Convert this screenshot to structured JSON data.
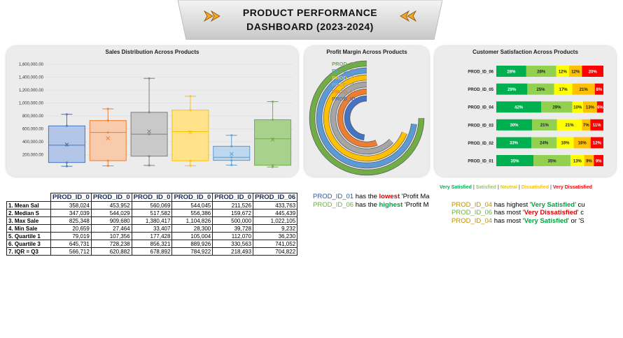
{
  "title": {
    "line1": "PRODUCT PERFORMANCE",
    "line2": "DASHBOARD (2023-2024)"
  },
  "sales_panel": {
    "title": "Sales Distribution Across Products"
  },
  "margin_panel": {
    "title": "Profit Margin Across Products"
  },
  "satisfaction_panel": {
    "title": "Customer Satisfaction Across Products"
  },
  "chart_data": [
    {
      "type": "box",
      "title": "Sales Distribution Across Products",
      "y_ticks": [
        "1,600,000.00",
        "1,400,000.00",
        "1,200,000.00",
        "1,000,000.00",
        "800,000.00",
        "600,000.00",
        "400,000.00",
        "200,000.00"
      ],
      "ylim": [
        0,
        1600000
      ],
      "series": [
        {
          "min": 20659,
          "q1": 79019,
          "median": 347039,
          "q3": 645731,
          "max": 825348,
          "mean": 358024,
          "color": "#4472c4",
          "fill": "#b4c6e7"
        },
        {
          "min": 27464,
          "q1": 107356,
          "median": 544029,
          "q3": 728238,
          "max": 909680,
          "mean": 453952,
          "color": "#ed7d31",
          "fill": "#f8cbad"
        },
        {
          "min": 33407,
          "q1": 177428,
          "median": 517582,
          "q3": 856321,
          "max": 1380417,
          "mean": 560069,
          "color": "#7f7f7f",
          "fill": "#c9c9c9"
        },
        {
          "min": 28300,
          "q1": 105004,
          "median": 556386,
          "q3": 889926,
          "max": 1104826,
          "mean": 544045,
          "color": "#ffc000",
          "fill": "#ffe28a"
        },
        {
          "min": 39728,
          "q1": 112070,
          "median": 159672,
          "q3": 330563,
          "max": 500000,
          "mean": 211526,
          "color": "#5b9bd5",
          "fill": "#bdd7ee"
        },
        {
          "min": 9232,
          "q1": 36230,
          "median": 445439,
          "q3": 741052,
          "max": 1022105,
          "mean": 433763,
          "color": "#70ad47",
          "fill": "#a9d18e"
        }
      ]
    },
    {
      "type": "radial-bar",
      "title": "Profit Margin Across Products",
      "categories": [
        "PROD_ID_06",
        "PROD_ID_05",
        "PROD_ID_04",
        "PROD_ID_03",
        "PROD_ID_02",
        "PROD_ID_01"
      ],
      "values": [
        0.75,
        0.73,
        0.69,
        0.63,
        0.56,
        0.48
      ],
      "colors": [
        "#70ad47",
        "#5b9bd5",
        "#ffc000",
        "#a5a5a5",
        "#ed7d31",
        "#4472c4"
      ]
    },
    {
      "type": "stacked-bar",
      "title": "Customer Satisfaction Across Products",
      "categories": [
        "PROD_ID_06",
        "PROD_ID_05",
        "PROD_ID_04",
        "PROD_ID_03",
        "PROD_ID_02",
        "PROD_ID_01"
      ],
      "series": [
        {
          "name": "Very Satisfied",
          "color": "#00b050",
          "values": [
            28,
            29,
            42,
            30,
            33,
            35
          ]
        },
        {
          "name": "Satisfied",
          "color": "#92d050",
          "values": [
            28,
            25,
            29,
            21,
            24,
            35
          ]
        },
        {
          "name": "Neutral",
          "color": "#ffff00",
          "values": [
            12,
            17,
            10,
            21,
            16,
            13
          ]
        },
        {
          "name": "Dissatisfied",
          "color": "#ffc000",
          "values": [
            12,
            21,
            13,
            7,
            16,
            9
          ]
        },
        {
          "name": "Very Dissatisfied",
          "color": "#ff0000",
          "values": [
            20,
            8,
            6,
            11,
            12,
            9
          ]
        }
      ]
    }
  ],
  "stats_table": {
    "headers": [
      "PROD_ID_0",
      "PROD_ID_0",
      "PROD_ID_0",
      "PROD_ID_0",
      "PROD_ID_0",
      "PROD_ID_06"
    ],
    "rows": [
      {
        "label": "1. Mean Sal",
        "values": [
          "358,024",
          "453,952",
          "560,069",
          "544,045",
          "211,526",
          "433,763"
        ]
      },
      {
        "label": "2. Median S",
        "values": [
          "347,039",
          "544,029",
          "517,582",
          "556,386",
          "159,672",
          "445,439"
        ]
      },
      {
        "label": "3. Max Sale",
        "values": [
          "825,348",
          "909,680",
          "1,380,417",
          "1,104,826",
          "500,000",
          "1,022,105"
        ]
      },
      {
        "label": "4. Min Sale",
        "values": [
          "20,659",
          "27,464",
          "33,407",
          "28,300",
          "39,728",
          "9,232"
        ]
      },
      {
        "label": "5. Quartile 1",
        "values": [
          "79,019",
          "107,356",
          "177,428",
          "105,004",
          "112,070",
          "36,230"
        ]
      },
      {
        "label": "6. Quartile 3",
        "values": [
          "645,731",
          "728,238",
          "856,321",
          "889,926",
          "330,563",
          "741,052"
        ]
      },
      {
        "label": "7. IQR = Q3",
        "values": [
          "566,712",
          "620,882",
          "678,892",
          "784,922",
          "218,493",
          "704,822"
        ]
      }
    ]
  },
  "insights": {
    "i1": {
      "prod": "PROD_ID_01",
      "pre": " has the ",
      "key": "lowest",
      "post": " 'Profit Ma"
    },
    "i2": {
      "prod": "PROD_ID_06",
      "pre": " has the ",
      "key": "highest",
      "post": " 'Profit M"
    },
    "i3": {
      "prod": "PROD_ID_04",
      "pre": " has highest '",
      "key": "Very Satisfied",
      "post": "' cu"
    },
    "i4": {
      "prod": "PROD_ID_06",
      "pre": " has most '",
      "key": "Very Dissatisfied",
      "post": "' c"
    },
    "i5": {
      "prod": "PROD_ID_04",
      "pre": " has most '",
      "key": "Very Satisfied",
      "post": "' or 'S"
    }
  },
  "legend": {
    "sep": " | ",
    "items": [
      "Very Satisfied",
      "Satisfied",
      "Neutral",
      "Dissatisfied",
      "Very Dissatisfied"
    ]
  }
}
